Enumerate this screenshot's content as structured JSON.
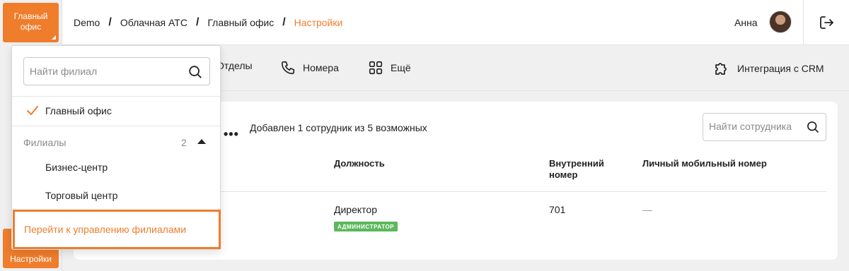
{
  "rail": {
    "branch_button": "Главный офис",
    "settings_button": "Настройки"
  },
  "header": {
    "breadcrumbs": [
      "Demo",
      "Облачная АТС",
      "Главный офис",
      "Настройки"
    ],
    "separator": "/",
    "user_name": "Анна"
  },
  "tabs": {
    "departments": "Отделы",
    "numbers": "Номера",
    "more": "Ещё",
    "crm": "Интеграция с CRM"
  },
  "employees": {
    "more_menu": "•••",
    "summary": "Добавлен 1 сотрудник из 5 возможных",
    "search_placeholder": "Найти сотрудника",
    "columns": {
      "position": "Должность",
      "internal_number_line1": "Внутренний",
      "internal_number_line2": "номер",
      "mobile": "Личный мобильный номер"
    },
    "rows": [
      {
        "position": "Директор",
        "role_badge": "АДМИНИСТРАТОР",
        "internal_number": "701",
        "mobile": "—"
      }
    ]
  },
  "branch_dropdown": {
    "search_placeholder": "Найти филиал",
    "selected_branch": "Главный офис",
    "group_label": "Филиалы",
    "group_count": "2",
    "branches": [
      "Бизнес-центр",
      "Торговый центр"
    ],
    "manage_link": "Перейти к управлению филиалами"
  },
  "colors": {
    "accent": "#ef7d2c",
    "badge_green": "#5cb85c"
  }
}
